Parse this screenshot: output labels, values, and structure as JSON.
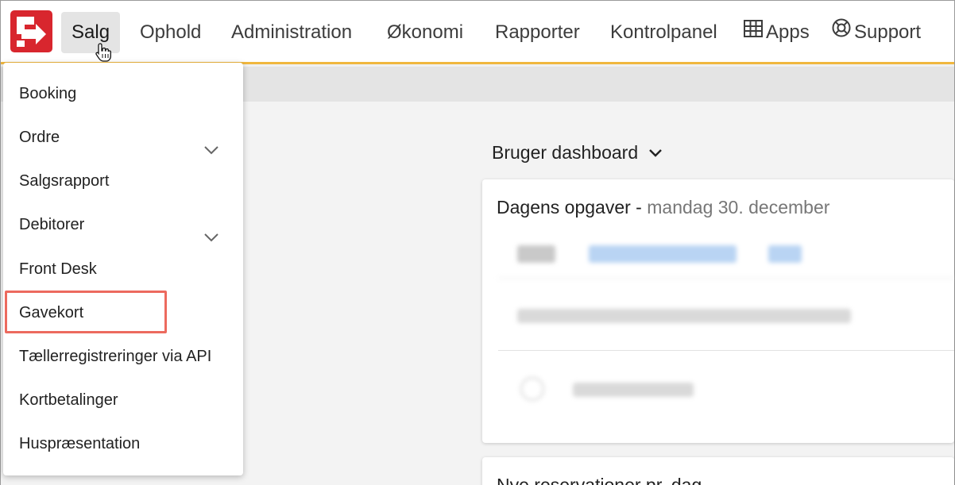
{
  "nav": {
    "items": [
      {
        "label": "Salg",
        "active": true
      },
      {
        "label": "Ophold"
      },
      {
        "label": "Administration"
      },
      {
        "label": "Økonomi"
      },
      {
        "label": "Rapporter"
      },
      {
        "label": "Kontrolpanel"
      },
      {
        "label": "Apps",
        "icon": "grid-icon"
      },
      {
        "label": "Support",
        "icon": "lifebuoy-icon"
      }
    ]
  },
  "salg_menu": {
    "items": [
      {
        "label": "Booking"
      },
      {
        "label": "Ordre",
        "expandable": true
      },
      {
        "label": "Salgsrapport"
      },
      {
        "label": "Debitorer",
        "expandable": true
      },
      {
        "label": "Front Desk"
      },
      {
        "label": "Gavekort",
        "highlighted": true
      },
      {
        "label": "Tællerregistreringer via API"
      },
      {
        "label": "Kortbetalinger"
      },
      {
        "label": "Huspræsentation"
      }
    ]
  },
  "dashboard": {
    "title": "Bruger dashboard",
    "tasks_card": {
      "title": "Dagens opgaver",
      "separator": " - ",
      "date": "mandag 30. december"
    },
    "second_card": {
      "title": "Nye reservationer pr. dag"
    }
  },
  "colors": {
    "brand_red": "#d8262e",
    "accent_yellow": "#f0b73e",
    "highlight": "#ec6a5e"
  }
}
